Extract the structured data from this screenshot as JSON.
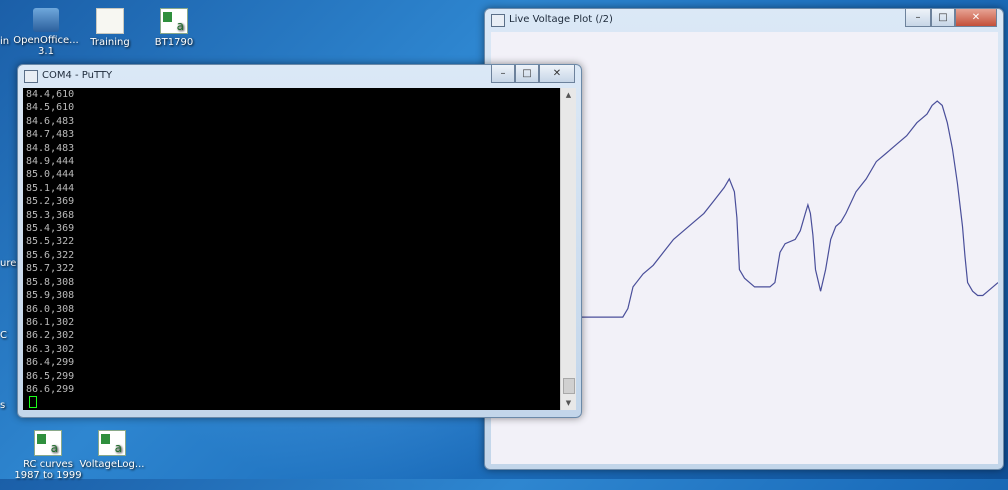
{
  "desktop": {
    "icons": [
      {
        "label": "OpenOffice...",
        "sublabel": "3.1",
        "icon": "openoffice-icon"
      },
      {
        "label": "Training",
        "icon": "folder-icon"
      },
      {
        "label": "BT1790",
        "icon": "excel-file-icon"
      },
      {
        "label": "RC curves",
        "sublabel": "1987 to 1999",
        "icon": "excel-file-icon"
      },
      {
        "label": "VoltageLog...",
        "icon": "excel-file-icon"
      }
    ],
    "edge_labels": [
      "in",
      "ure",
      "C",
      "s"
    ]
  },
  "putty": {
    "title": "COM4 - PuTTY",
    "lines": [
      "84.4,610",
      "84.5,610",
      "84.6,483",
      "84.7,483",
      "84.8,483",
      "84.9,444",
      "85.0,444",
      "85.1,444",
      "85.2,369",
      "85.3,368",
      "85.4,369",
      "85.5,322",
      "85.6,322",
      "85.7,322",
      "85.8,308",
      "85.9,308",
      "86.0,308",
      "86.1,302",
      "86.2,302",
      "86.3,302",
      "86.4,299",
      "86.5,299",
      "86.6,299"
    ]
  },
  "plot_window": {
    "title": "Live Voltage Plot (/2)"
  },
  "chart_data": {
    "type": "line",
    "title": "",
    "xlabel": "",
    "ylabel": "",
    "grid": false,
    "color": "#4a4f9a",
    "xlim": [
      0,
      100
    ],
    "ylim": [
      0,
      100
    ],
    "x": [
      0,
      26,
      27,
      28,
      30,
      32,
      34,
      36,
      38,
      40,
      42,
      44,
      46,
      47,
      48,
      48.5,
      49,
      50,
      52,
      54,
      55,
      56,
      57,
      58,
      60,
      61,
      62,
      62.5,
      63,
      63.5,
      64,
      65,
      66,
      67,
      68,
      69,
      70,
      72,
      74,
      76,
      78,
      80,
      82,
      84,
      85,
      86,
      87,
      88,
      89,
      90,
      91,
      92,
      93,
      93.5,
      94,
      95,
      96,
      97,
      98,
      99,
      100
    ],
    "y": [
      34,
      34,
      36,
      41,
      44,
      46,
      49,
      52,
      54,
      56,
      58,
      61,
      64,
      66,
      63,
      57,
      45,
      43,
      41,
      41,
      41,
      42,
      49,
      51,
      52,
      54,
      58,
      60,
      58,
      53,
      45,
      40,
      45,
      52,
      55,
      56,
      58,
      63,
      66,
      70,
      72,
      74,
      76,
      79,
      80,
      81,
      83,
      84,
      83,
      79,
      73,
      65,
      55,
      48,
      42,
      40,
      39,
      39,
      40,
      41,
      42
    ]
  }
}
